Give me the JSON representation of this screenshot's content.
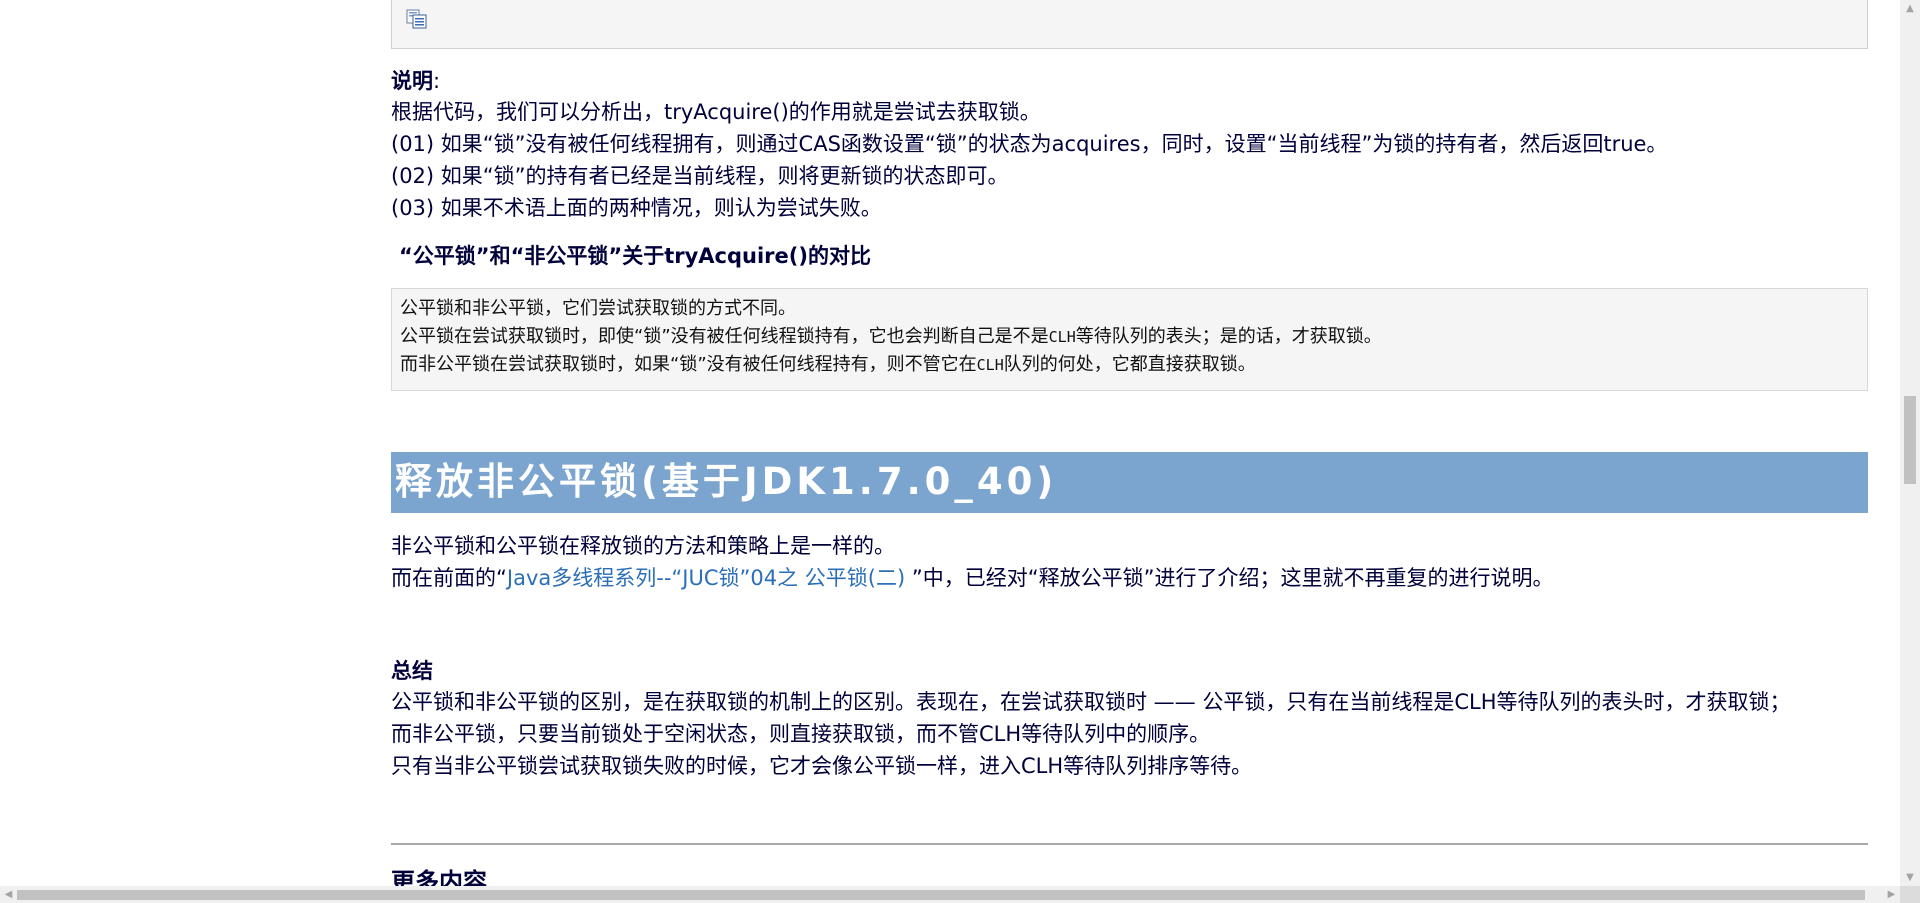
{
  "code_box": {
    "copy_icon": "copy-icon"
  },
  "explanation": {
    "label": "说明",
    "colon": ":",
    "lines": [
      "根据代码，我们可以分析出，tryAcquire()的作用就是尝试去获取锁。",
      "(01) 如果“锁”没有被任何线程拥有，则通过CAS函数设置“锁”的状态为acquires，同时，设置“当前线程”为锁的持有者，然后返回true。",
      "(02) 如果“锁”的持有者已经是当前线程，则将更新锁的状态即可。",
      "(03) 如果不术语上面的两种情况，则认为尝试失败。"
    ]
  },
  "comparison": {
    "heading": "“公平锁”和“非公平锁”关于tryAcquire()的对比",
    "note_line_1": "公平锁和非公平锁，它们尝试获取锁的方式不同。",
    "note_line_2_a": "公平锁在尝试获取锁时，即使“锁”没有被任何线程锁持有，它也会判断自己是不是",
    "note_line_2_mono": "CLH",
    "note_line_2_b": "等待队列的表头；是的话，才获取锁。",
    "note_line_3_a": "而非公平锁在尝试获取锁时，如果“锁”没有被任何线程持有，则不管它在",
    "note_line_3_mono": "CLH",
    "note_line_3_b": "队列的何处，它都直接获取锁。"
  },
  "release_section": {
    "title": "释放非公平锁(基于JDK1.7.0_40)",
    "line_1": "非公平锁和公平锁在释放锁的方法和策略上是一样的。",
    "line_2_prefix": "而在前面的“",
    "line_2_link": "Java多线程系列--“JUC锁”04之 公平锁(二)",
    "line_2_suffix": " ”中，已经对“释放公平锁”进行了介绍；这里就不再重复的进行说明。"
  },
  "summary": {
    "label": "总结",
    "lines": [
      "公平锁和非公平锁的区别，是在获取锁的机制上的区别。表现在，在尝试获取锁时 —— 公平锁，只有在当前线程是CLH等待队列的表头时，才获取锁；",
      "而非公平锁，只要当前锁处于空闲状态，则直接获取锁，而不管CLH等待队列中的顺序。",
      "只有当非公平锁尝试获取锁失败的时候，它才会像公平锁一样，进入CLH等待队列排序等待。"
    ]
  },
  "more": {
    "heading": "更多内容"
  },
  "scrollbars": {
    "up_arrow": "▲",
    "down_arrow": "▼",
    "left_arrow": "◀",
    "right_arrow": "▶"
  }
}
